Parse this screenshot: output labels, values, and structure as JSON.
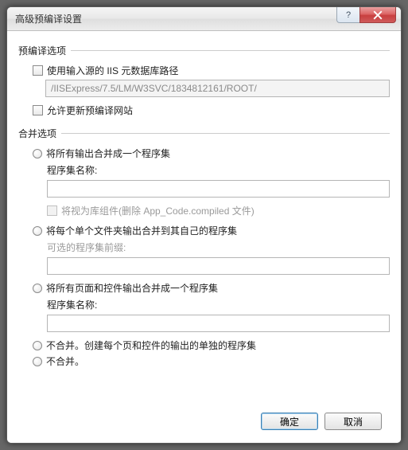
{
  "window": {
    "title": "高级预编译设置"
  },
  "precompile": {
    "section_label": "预编译选项",
    "use_source_iis": {
      "label": "使用输入源的 IIS 元数据库路径",
      "value": "/IISExpress/7.5/LM/W3SVC/1834812161/ROOT/"
    },
    "allow_update": {
      "label": "允许更新预编译网站"
    }
  },
  "merge": {
    "section_label": "合并选项",
    "opt1": {
      "label": "将所有输出合并成一个程序集",
      "asm_name_label": "程序集名称:",
      "treat_as_lib_label": "将视为库组件(删除 App_Code.compiled 文件)"
    },
    "opt2": {
      "label": "将每个单个文件夹输出合并到其自己的程序集",
      "prefix_label": "可选的程序集前缀:"
    },
    "opt3": {
      "label": "将所有页面和控件输出合并成一个程序集",
      "asm_name_label": "程序集名称:"
    },
    "opt4": {
      "label": "不合并。创建每个页和控件的输出的单独的程序集"
    },
    "opt5": {
      "label": "不合并。"
    }
  },
  "buttons": {
    "ok": "确定",
    "cancel": "取消"
  }
}
